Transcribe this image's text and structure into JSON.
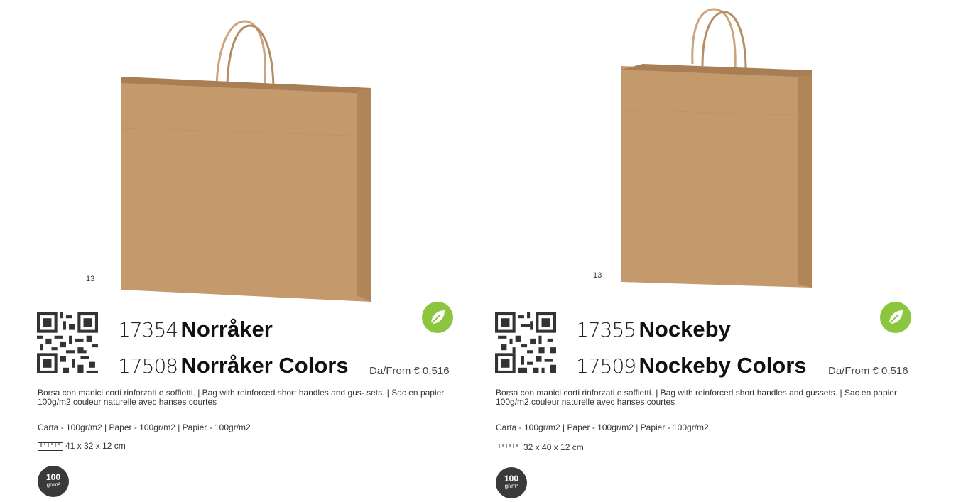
{
  "products": [
    {
      "variant_code": ".13",
      "code1": "17354",
      "name1": "Norråker",
      "code2": "17508",
      "name2": "Norråker Colors",
      "price": "Da/From € 0,516",
      "description": "Borsa con manici corti rinforzati e soffietti. | Bag with reinforced short handles and gus- sets. | Sac en papier 100g/m2 couleur naturelle avec hanses courtes",
      "material": "Carta - 100gr/m2 | Paper - 100gr/m2 | Papier - 100gr/m2",
      "dimensions": "41 x 32 x 12 cm",
      "grammage": "100",
      "grammage_unit": "gr/m²",
      "icons": [
        "qr-code-icon",
        "eco-leaf-icon",
        "ruler-icon"
      ]
    },
    {
      "variant_code": ".13",
      "code1": "17355",
      "name1": "Nockeby",
      "code2": "17509",
      "name2": "Nockeby Colors",
      "price": "Da/From € 0,516",
      "description": "Borsa con manici corti rinforzati e soffietti. | Bag with reinforced short handles and gussets. | Sac en papier 100g/m2 couleur naturelle avec hanses courtes",
      "material": "Carta - 100gr/m2 | Paper - 100gr/m2 | Papier - 100gr/m2",
      "dimensions": "32 x 40 x 12 cm",
      "grammage": "100",
      "grammage_unit": "gr/m²",
      "icons": [
        "qr-code-icon",
        "eco-leaf-icon",
        "ruler-icon"
      ]
    }
  ],
  "colors": {
    "kraft": "#c49a6c",
    "eco_green": "#8cc63f",
    "badge_dark": "#3a3a3a"
  }
}
